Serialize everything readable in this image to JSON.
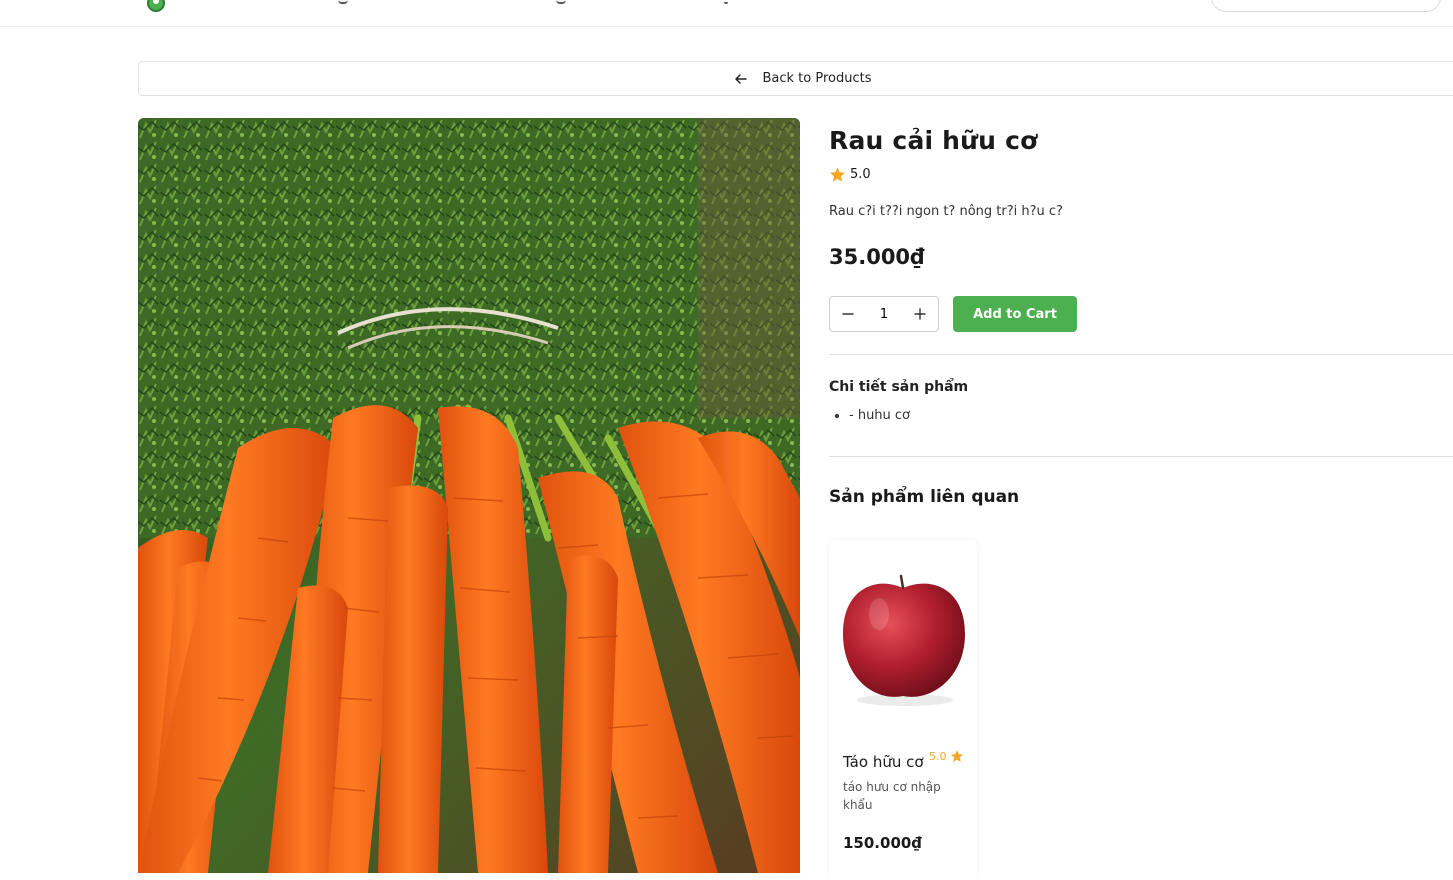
{
  "back": {
    "label": "Back to Products"
  },
  "product": {
    "name": "Rau cải hữu cơ",
    "rating": "5.0",
    "description": "Rau c?i t??i ngon t? nông tr?i h?u c?",
    "price": "35.000₫",
    "quantity": "1",
    "add_to_cart_label": "Add to Cart",
    "details_title": "Chi tiết sản phẩm",
    "details": [
      "- huhu cơ"
    ]
  },
  "related": {
    "title": "Sản phẩm liên quan",
    "items": [
      {
        "name": "Táo hữu cơ",
        "rating": "5.0",
        "description": "táo hưu cơ nhập khẩu",
        "price": "150.000₫"
      }
    ]
  },
  "colors": {
    "accent": "#4caf50",
    "star": "#f5a623"
  },
  "icons": [
    "logo-icon",
    "arrow-left-icon",
    "star-icon",
    "minus-icon",
    "plus-icon"
  ]
}
